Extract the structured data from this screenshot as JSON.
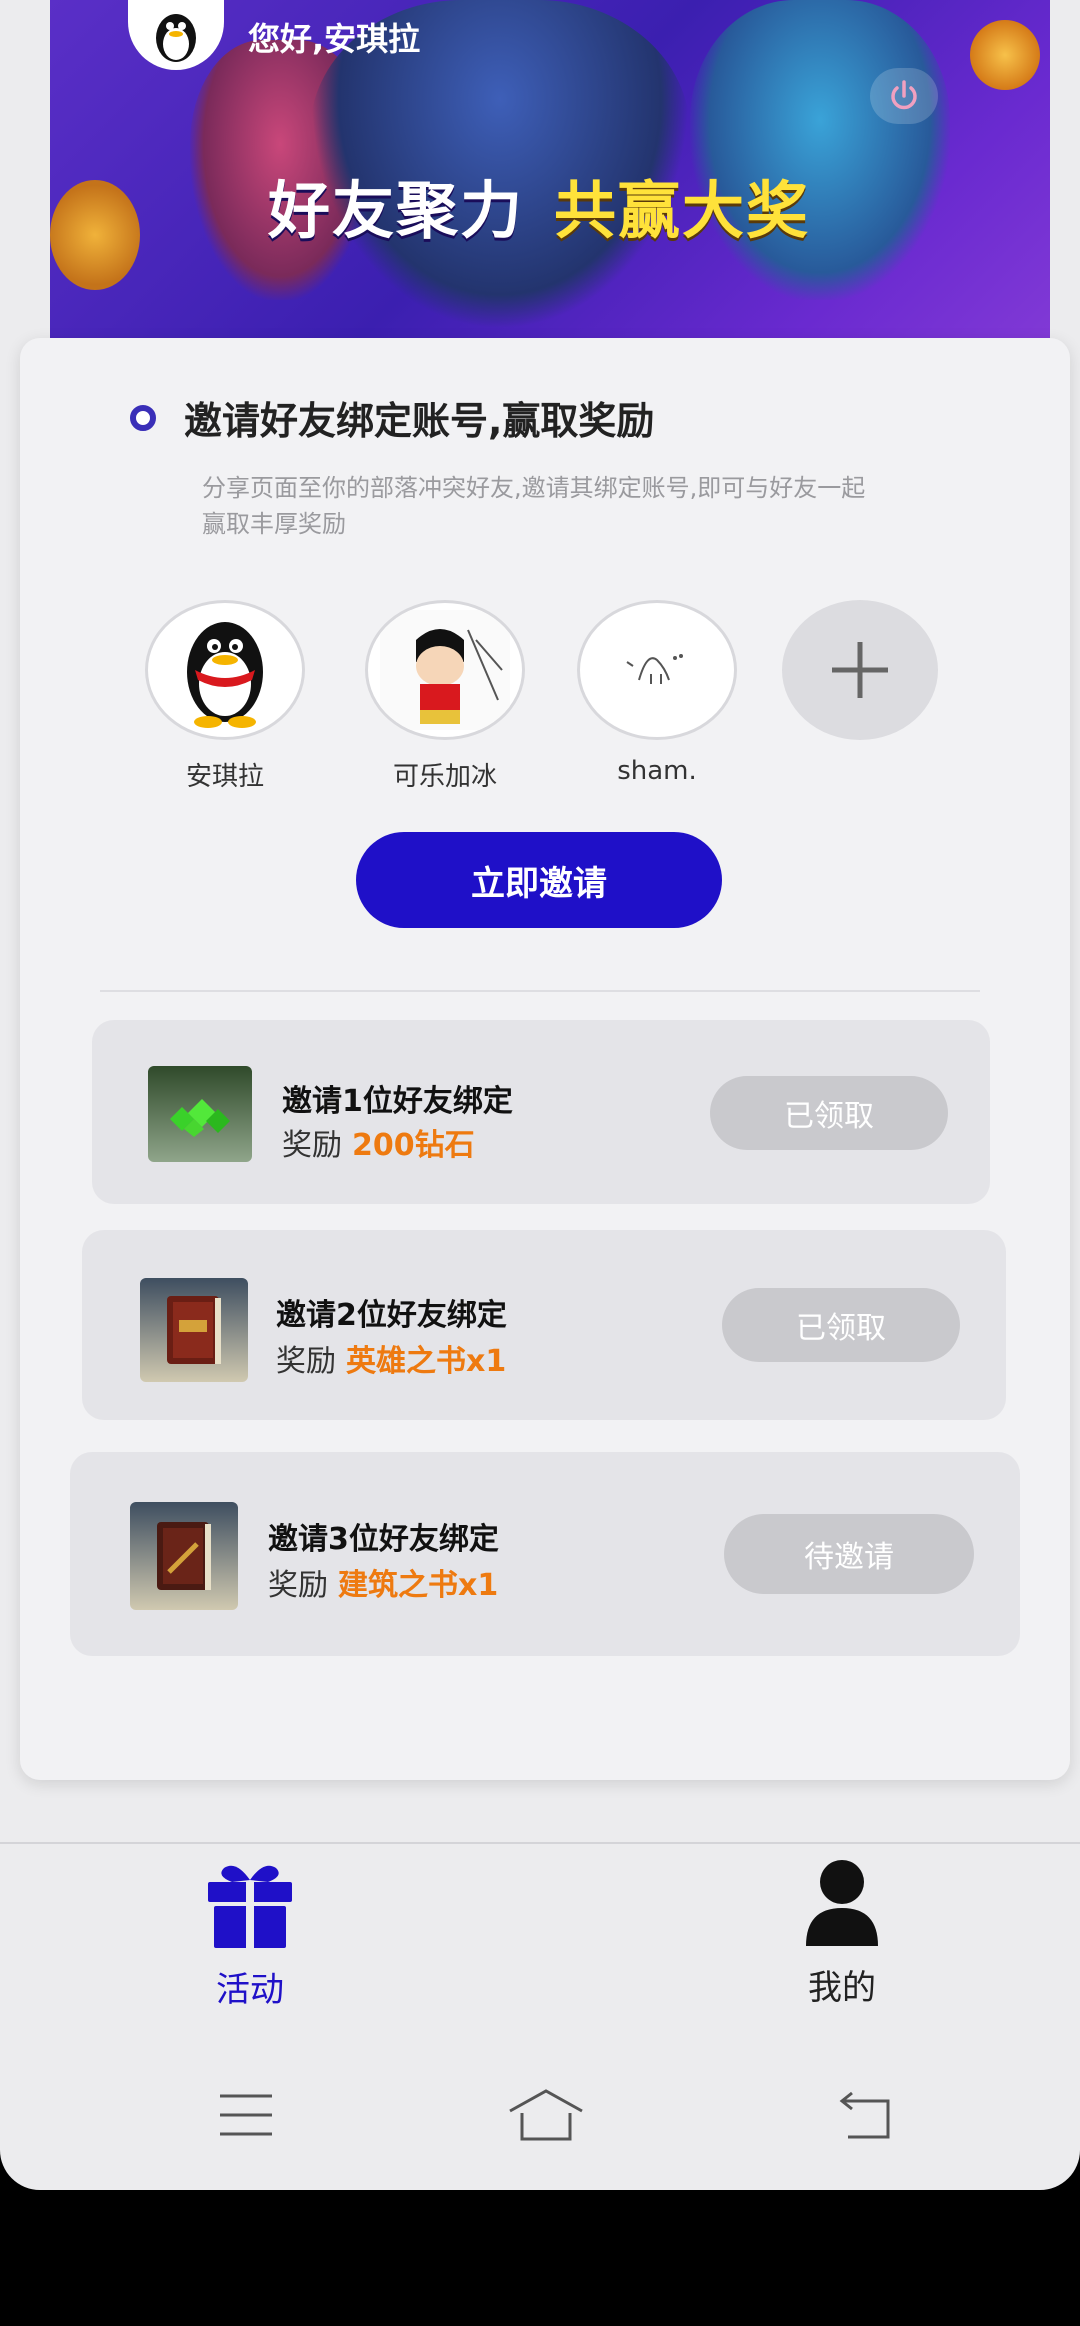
{
  "header": {
    "greeting": "您好,安琪拉",
    "slogan_left": "好友聚力",
    "slogan_right": "共赢大奖"
  },
  "invite": {
    "title": "邀请好友绑定账号,赢取奖励",
    "description": "分享页面至你的部落冲突好友,邀请其绑定账号,即可与好友一起赢取丰厚奖励",
    "friends": [
      {
        "name": "安琪拉"
      },
      {
        "name": "可乐加冰"
      },
      {
        "name": "sham."
      }
    ],
    "button_label": "立即邀请"
  },
  "tasks": [
    {
      "title": "邀请1位好友绑定",
      "reward_label": "奖励",
      "reward": "200钻石",
      "status": "已领取",
      "icon": "gem-icon"
    },
    {
      "title": "邀请2位好友绑定",
      "reward_label": "奖励",
      "reward": "英雄之书x1",
      "status": "已领取",
      "icon": "book-of-heroes-icon"
    },
    {
      "title": "邀请3位好友绑定",
      "reward_label": "奖励",
      "reward": "建筑之书x1",
      "status": "待邀请",
      "icon": "book-of-building-icon"
    }
  ],
  "nav": {
    "activity": "活动",
    "mine": "我的"
  },
  "colors": {
    "primary": "#1f10c8",
    "reward": "#ee7a10",
    "disabled": "#c9c9cd"
  }
}
